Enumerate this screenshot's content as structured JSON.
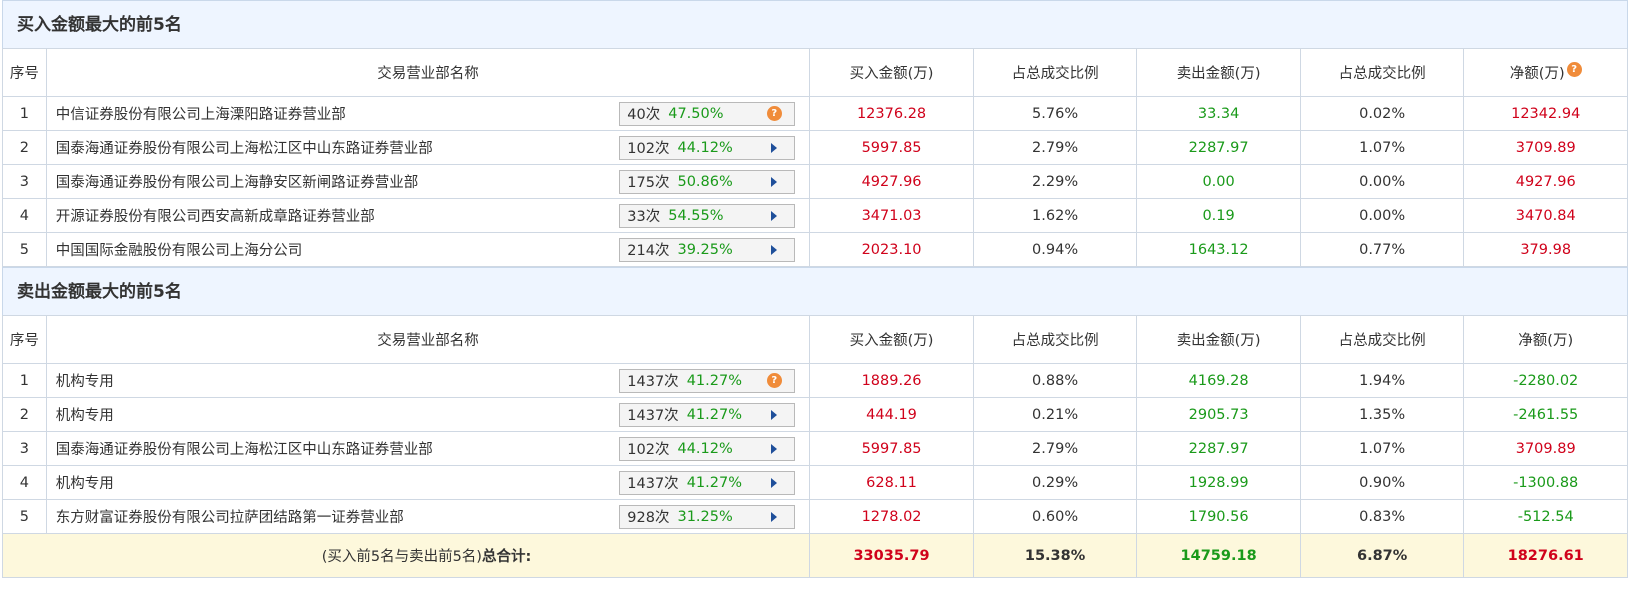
{
  "buy_section": {
    "title": "买入金额最大的前5名",
    "headers": {
      "seq": "序号",
      "name": "交易营业部名称",
      "buy": "买入金额(万)",
      "buy_ratio": "占总成交比例",
      "sell": "卖出金额(万)",
      "sell_ratio": "占总成交比例",
      "net": "净额(万)"
    },
    "rows": [
      {
        "seq": "1",
        "name": "中信证券股份有限公司上海溧阳路证券营业部",
        "times": "40次",
        "pct": "47.50%",
        "icon": "help-icon",
        "buy": "12376.28",
        "buy_ratio": "5.76%",
        "sell": "33.34",
        "sell_ratio": "0.02%",
        "net": "12342.94"
      },
      {
        "seq": "2",
        "name": "国泰海通证券股份有限公司上海松江区中山东路证券营业部",
        "times": "102次",
        "pct": "44.12%",
        "icon": "play-arrow-icon",
        "buy": "5997.85",
        "buy_ratio": "2.79%",
        "sell": "2287.97",
        "sell_ratio": "1.07%",
        "net": "3709.89"
      },
      {
        "seq": "3",
        "name": "国泰海通证券股份有限公司上海静安区新闸路证券营业部",
        "times": "175次",
        "pct": "50.86%",
        "icon": "play-arrow-icon",
        "buy": "4927.96",
        "buy_ratio": "2.29%",
        "sell": "0.00",
        "sell_ratio": "0.00%",
        "net": "4927.96"
      },
      {
        "seq": "4",
        "name": "开源证券股份有限公司西安高新成章路证券营业部",
        "times": "33次",
        "pct": "54.55%",
        "icon": "play-arrow-icon",
        "buy": "3471.03",
        "buy_ratio": "1.62%",
        "sell": "0.19",
        "sell_ratio": "0.00%",
        "net": "3470.84"
      },
      {
        "seq": "5",
        "name": "中国国际金融股份有限公司上海分公司",
        "times": "214次",
        "pct": "39.25%",
        "icon": "play-arrow-icon",
        "buy": "2023.10",
        "buy_ratio": "0.94%",
        "sell": "1643.12",
        "sell_ratio": "0.77%",
        "net": "379.98"
      }
    ]
  },
  "sell_section": {
    "title": "卖出金额最大的前5名",
    "headers": {
      "seq": "序号",
      "name": "交易营业部名称",
      "buy": "买入金额(万)",
      "buy_ratio": "占总成交比例",
      "sell": "卖出金额(万)",
      "sell_ratio": "占总成交比例",
      "net": "净额(万)"
    },
    "rows": [
      {
        "seq": "1",
        "name": "机构专用",
        "times": "1437次",
        "pct": "41.27%",
        "icon": "help-icon",
        "buy": "1889.26",
        "buy_ratio": "0.88%",
        "sell": "4169.28",
        "sell_ratio": "1.94%",
        "net": "-2280.02"
      },
      {
        "seq": "2",
        "name": "机构专用",
        "times": "1437次",
        "pct": "41.27%",
        "icon": "play-arrow-icon",
        "buy": "444.19",
        "buy_ratio": "0.21%",
        "sell": "2905.73",
        "sell_ratio": "1.35%",
        "net": "-2461.55"
      },
      {
        "seq": "3",
        "name": "国泰海通证券股份有限公司上海松江区中山东路证券营业部",
        "times": "102次",
        "pct": "44.12%",
        "icon": "play-arrow-icon",
        "buy": "5997.85",
        "buy_ratio": "2.79%",
        "sell": "2287.97",
        "sell_ratio": "1.07%",
        "net": "3709.89"
      },
      {
        "seq": "4",
        "name": "机构专用",
        "times": "1437次",
        "pct": "41.27%",
        "icon": "play-arrow-icon",
        "buy": "628.11",
        "buy_ratio": "0.29%",
        "sell": "1928.99",
        "sell_ratio": "0.90%",
        "net": "-1300.88"
      },
      {
        "seq": "5",
        "name": "东方财富证券股份有限公司拉萨团结路第一证券营业部",
        "times": "928次",
        "pct": "31.25%",
        "icon": "play-arrow-icon",
        "buy": "1278.02",
        "buy_ratio": "0.60%",
        "sell": "1790.56",
        "sell_ratio": "0.83%",
        "net": "-512.54"
      }
    ],
    "total": {
      "label_prefix": "(买入前5名与卖出前5名)",
      "label_bold": "总合计:",
      "buy": "33035.79",
      "buy_ratio": "15.38%",
      "sell": "14759.18",
      "sell_ratio": "6.87%",
      "net": "18276.61"
    }
  },
  "colors": {
    "buy_value": "#d0021b",
    "sell_value": "#1a9a1a",
    "section_header_bg": "#eef5ff",
    "total_row_bg": "#fdf8dc",
    "help_icon": "#f08c3a",
    "arrow_icon": "#1f4f9a"
  }
}
